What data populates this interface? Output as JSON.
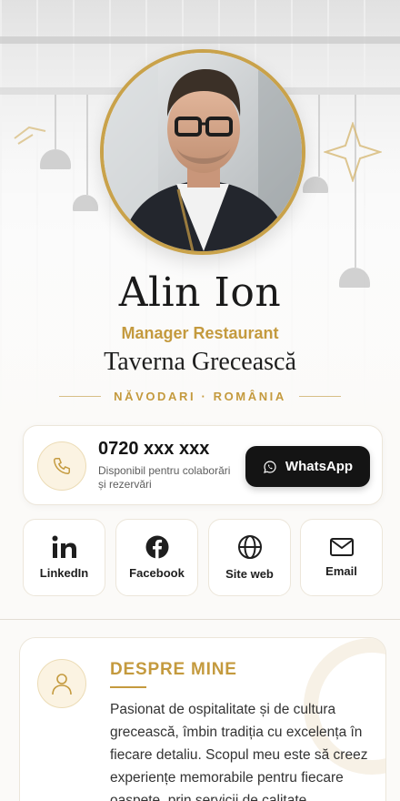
{
  "profile": {
    "name": "Alin Ion",
    "role": "Manager Restaurant",
    "company": "Taverna Grecească",
    "location": "NĂVODARI · ROMÂNIA"
  },
  "contact": {
    "phone": "0720 xxx xxx",
    "availability": "Disponibil pentru colaborări și rezervări",
    "whatsapp_label": "WhatsApp"
  },
  "socials": [
    {
      "label": "LinkedIn",
      "icon": "linkedin-icon"
    },
    {
      "label": "Facebook",
      "icon": "facebook-icon"
    },
    {
      "label": "Site web",
      "icon": "globe-icon"
    },
    {
      "label": "Email",
      "icon": "mail-icon"
    }
  ],
  "about": {
    "title": "DESPRE MINE",
    "text": "Pasionat de ospitalitate și de cultura grecească, îmbin tradiția cu excelența în fiecare detaliu. Scopul meu este să creez experiențe memorabile pentru fiecare oaspete, prin servicii de calitate"
  },
  "colors": {
    "accent": "#c49a3e",
    "dark_button": "#141414",
    "background": "#fbfaf8"
  }
}
